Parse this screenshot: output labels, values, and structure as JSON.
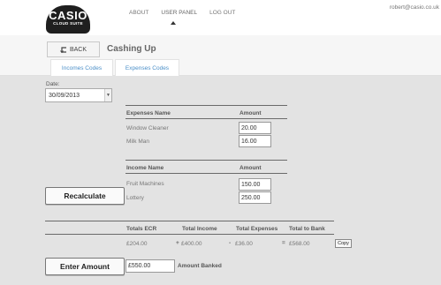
{
  "header": {
    "logo_main": "CASIO",
    "logo_sub": "CLOUD SUITE",
    "nav": [
      "ABOUT",
      "USER PANEL",
      "LOG OUT"
    ],
    "active_nav": "USER PANEL",
    "user_email": "robert@casio.co.uk"
  },
  "subheader": {
    "back_label": "BACK",
    "title": "Cashing Up",
    "tabs": [
      "Incomes Codes",
      "Expenses Codes"
    ]
  },
  "date": {
    "label": "Date:",
    "value": "30/09/2013"
  },
  "expenses": {
    "headers": [
      "Expenses Name",
      "Amount"
    ],
    "rows": [
      {
        "name": "Window Cleaner",
        "amount": "20.00"
      },
      {
        "name": "Milk Man",
        "amount": "16.00"
      }
    ]
  },
  "incomes": {
    "headers": [
      "Income Name",
      "Amount"
    ],
    "rows": [
      {
        "name": "Fruit Machines",
        "amount": "150.00"
      },
      {
        "name": "Lottery",
        "amount": "250.00"
      }
    ]
  },
  "recalculate_label": "Recalculate",
  "totals": {
    "headers": [
      "Totals ECR",
      "Total Income",
      "Total Expenses",
      "Total to Bank"
    ],
    "values": [
      "£204.00",
      "£400.00",
      "£36.00",
      "£568.00"
    ],
    "ops": [
      "+",
      "-",
      "="
    ],
    "copy_label": "Copy"
  },
  "enter_amount_label": "Enter Amount",
  "amount_banked": {
    "value": "£550.00",
    "label": "Amount Banked"
  }
}
